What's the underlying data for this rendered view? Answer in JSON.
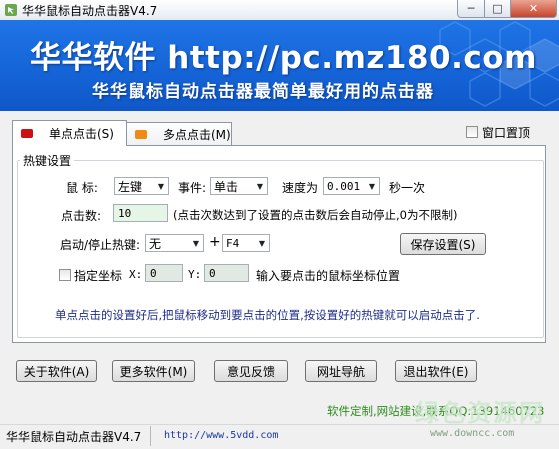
{
  "window": {
    "title": "华华鼠标自动点击器V4.7",
    "minimize_glyph": "─",
    "maximize_glyph": "□",
    "close_glyph": "✕"
  },
  "banner": {
    "title": "华华软件 http://pc.mz180.com",
    "subtitle": "华华鼠标自动点击器最简单最好用的点击器"
  },
  "tabs": [
    {
      "label": "单点点击(S)",
      "color": "#cc1111",
      "active": true
    },
    {
      "label": "多点点击(M)",
      "color": "#f08a12",
      "active": false
    }
  ],
  "topmost": {
    "label": "窗口置顶",
    "checked": false
  },
  "hotkey_group": {
    "legend": "热键设置",
    "mouse_label": "鼠 标:",
    "mouse_value": "左键",
    "event_label": "事件:",
    "event_value": "单击",
    "speed_label": "速度为",
    "speed_value": "0.001",
    "speed_unit": "秒一次",
    "clicks_label": "点击数:",
    "clicks_value": "10",
    "clicks_hint": "(点击次数达到了设置的点击数后会自动停止,0为不限制)",
    "hotkey_label": "启动/停止热键:",
    "hotkey_mod": "无",
    "plus": "+",
    "hotkey_key": "F4",
    "save_button": "保存设置(S)",
    "coord_label": "指定坐标",
    "coord_checked": false,
    "x_label": "X:",
    "x_value": "0",
    "y_label": "Y:",
    "y_value": "0",
    "coord_hint": "输入要点击的鼠标坐标位置",
    "instruction": "单点点击的设置好后,把鼠标移动到要点击的位置,按设置好的热键就可以启动点击了."
  },
  "buttons": {
    "about": "关于软件(A)",
    "more": "更多软件(M)",
    "feedback": "意见反馈",
    "nav": "网址导航",
    "exit": "退出软件(E)"
  },
  "footer": {
    "custom_text": "软件定制,网站建设,联系QQ:1391460723",
    "custom_color": "#2e8b1e"
  },
  "statusbar": {
    "app_name": "华华鼠标自动点击器V4.7",
    "url": "http://www.5vdd.com"
  },
  "watermark": {
    "line1": "绿色资源网",
    "line2": "www.downcc.com"
  }
}
